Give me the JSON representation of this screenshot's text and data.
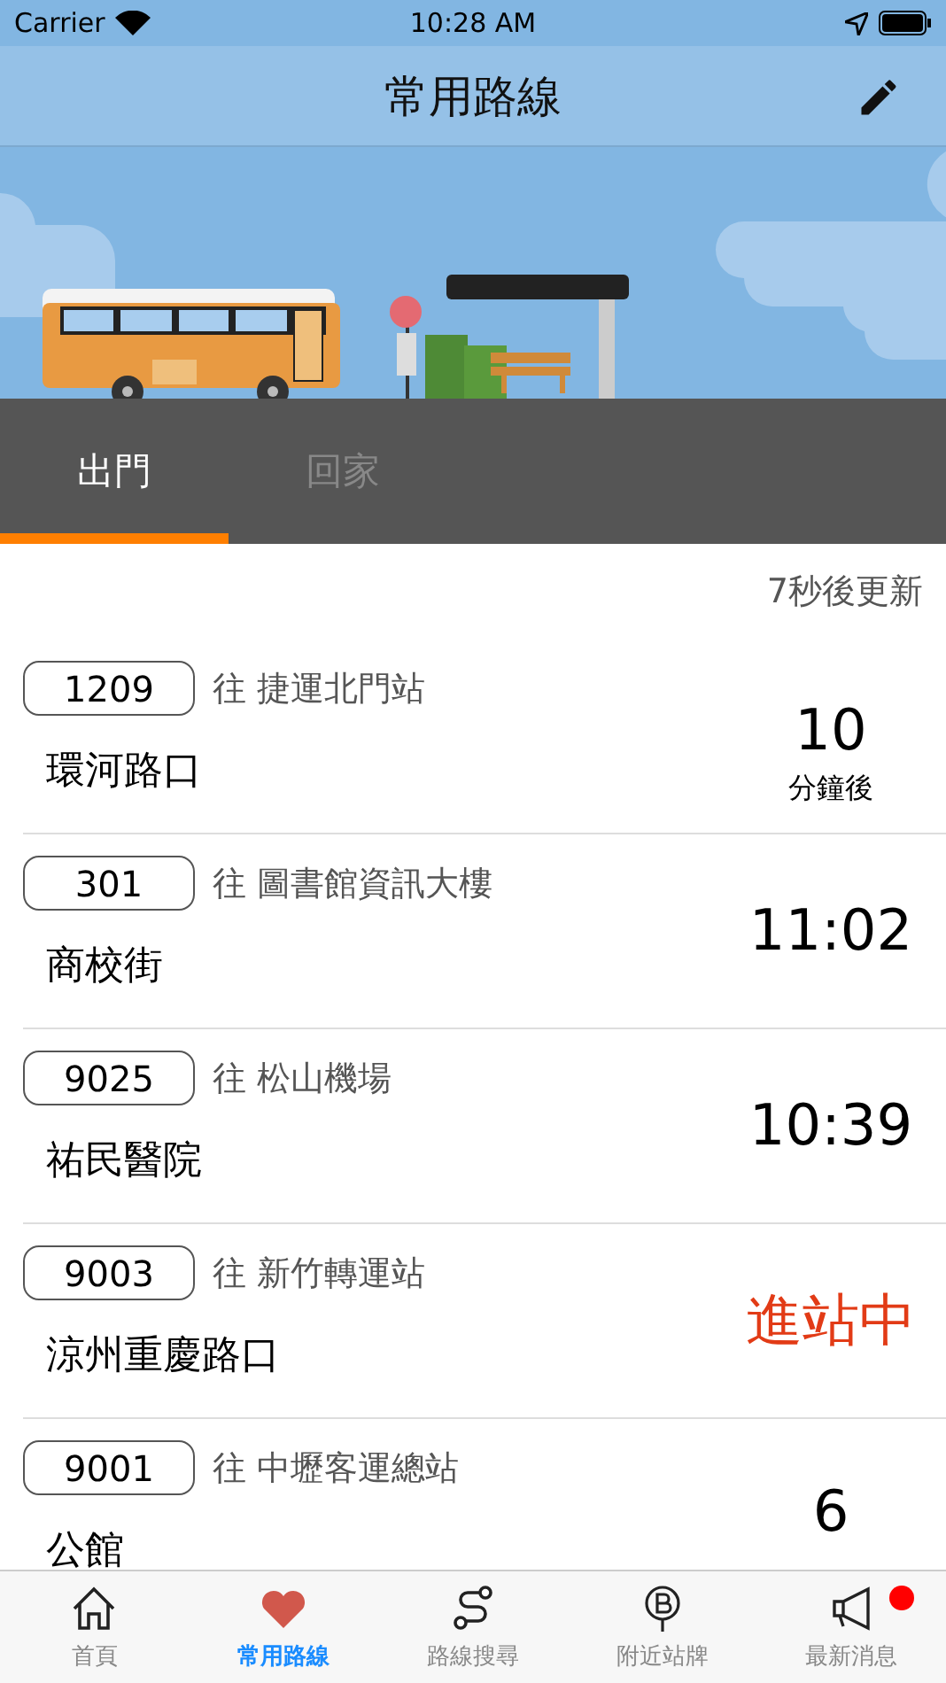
{
  "status_bar": {
    "carrier": "Carrier",
    "time": "10:28 AM"
  },
  "nav": {
    "title": "常用路線"
  },
  "tabs": [
    {
      "label": "出門",
      "selected": true
    },
    {
      "label": "回家",
      "selected": false
    }
  ],
  "update_note": "7秒後更新",
  "routes": [
    {
      "route": "1209",
      "destination": "往 捷運北門站",
      "stop": "環河路口",
      "kind": "minutes",
      "eta": "10",
      "unit": "分鐘後"
    },
    {
      "route": "301",
      "destination": "往 圖書館資訊大樓",
      "stop": "商校街",
      "kind": "clock",
      "eta": "11:02"
    },
    {
      "route": "9025",
      "destination": "往 松山機場",
      "stop": "祐民醫院",
      "kind": "clock",
      "eta": "10:39"
    },
    {
      "route": "9003",
      "destination": "往 新竹轉運站",
      "stop": "涼州重慶路口",
      "kind": "arriving",
      "eta": "進站中"
    },
    {
      "route": "9001",
      "destination": "往 中壢客運總站",
      "stop": "公館",
      "kind": "minutes",
      "eta": "6"
    }
  ],
  "tab_bar": [
    {
      "label": "首頁",
      "kind": "home",
      "selected": false,
      "badge": false
    },
    {
      "label": "常用路線",
      "kind": "heart",
      "selected": true,
      "badge": false
    },
    {
      "label": "路線搜尋",
      "kind": "route",
      "selected": false,
      "badge": false
    },
    {
      "label": "附近站牌",
      "kind": "stop",
      "selected": false,
      "badge": false
    },
    {
      "label": "最新消息",
      "kind": "news",
      "selected": false,
      "badge": true
    }
  ]
}
